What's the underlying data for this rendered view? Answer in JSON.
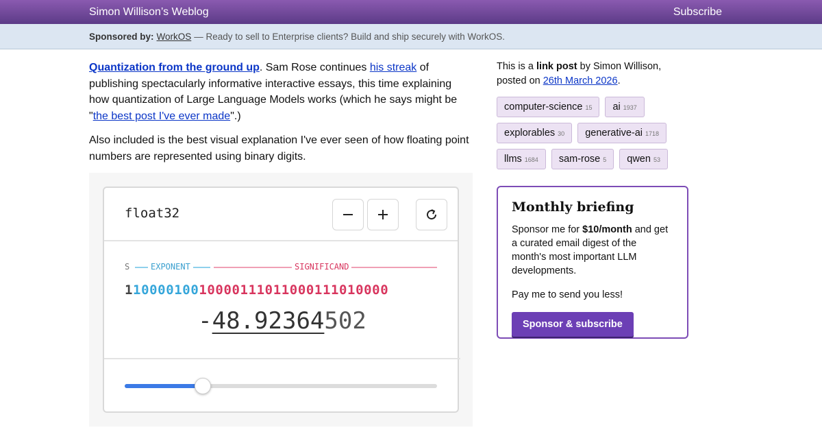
{
  "header": {
    "site_title": "Simon Willison’s Weblog",
    "subscribe_label": "Subscribe"
  },
  "sponsor": {
    "prefix": "Sponsored by:",
    "name": "WorkOS",
    "message": "— Ready to sell to Enterprise clients? Build and ship securely with WorkOS."
  },
  "post": {
    "title_link": "Quantization from the ground up",
    "p1_after_title": ". Sam Rose continues ",
    "p1_link": "his streak",
    "p1_middle": " of publishing spectacularly informative interactive essays, this time explaining how quantization of Large Language Models works (which he says might be \"",
    "p1_link2": "the best post I've ever made",
    "p1_end": "\".)",
    "p2": "Also included is the best visual explanation I've ever seen of how floating point numbers are represented using binary digits."
  },
  "widget": {
    "title": "float32",
    "label_sign": "S",
    "label_exponent": "EXPONENT",
    "label_significand": "SIGNIFICAND",
    "bits_sign": "1",
    "bits_exponent": "10000100",
    "bits_significand": "10000111011000111010000",
    "value_prefix": "-",
    "value_underlined": "48.92364",
    "value_rest": "502",
    "slider_fraction": 0.25,
    "icons": {
      "minus": "minus-icon",
      "plus": "plus-icon",
      "reset": "refresh-icon"
    }
  },
  "sidebar": {
    "meta_pre": "This is a ",
    "meta_bold": "link post",
    "meta_by": " by Simon Willison, posted on ",
    "meta_date": "26th March 2026",
    "meta_end": ".",
    "tags": [
      {
        "name": "computer-science",
        "count": "15"
      },
      {
        "name": "ai",
        "count": "1937"
      },
      {
        "name": "explorables",
        "count": "30"
      },
      {
        "name": "generative-ai",
        "count": "1718"
      },
      {
        "name": "llms",
        "count": "1684"
      },
      {
        "name": "sam-rose",
        "count": "5"
      },
      {
        "name": "qwen",
        "count": "53"
      }
    ],
    "briefing": {
      "title": "Monthly briefing",
      "text_pre": "Sponsor me for ",
      "text_bold": "$10/month",
      "text_post": " and get a curated email digest of the month's most important LLM developments.",
      "text2": "Pay me to send you less!",
      "button": "Sponsor & subscribe"
    }
  },
  "colors": {
    "header_bg": "#6b4596",
    "sponsor_bg": "#dce6f2",
    "exponent": "#35a6da",
    "significand": "#d8355e",
    "accent_purple": "#6c3fb5"
  }
}
